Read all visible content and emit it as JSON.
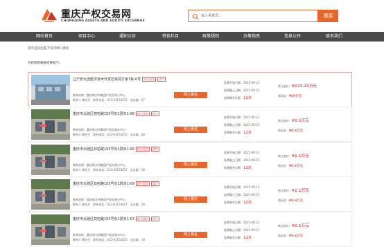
{
  "colors": {
    "accent": "#e8662c",
    "nav_bg": "#4a4a4a",
    "tag_red": "#e85d5d"
  },
  "header": {
    "title": "重庆产权交易网",
    "subtitle": "CHONGQING ASSETS AND EQUITY EXCHANGE",
    "logo_icon": "cqee-logo-icon"
  },
  "search": {
    "icon": "search-icon",
    "placeholder": "输入关键词...",
    "button_label": "搜索"
  },
  "nav": {
    "items": [
      "网站首页",
      "项目中心",
      "通知公告",
      "特色栏目",
      "政策规则",
      "办事指南",
      "信息公开",
      "联系我们"
    ]
  },
  "breadcrumb": "您的当前位置:产权项目>搜索",
  "result_label": "为您找到相关结果如下。",
  "listings": [
    {
      "title": "辽宁省大连经济技术开发区城润万家7栋-6号",
      "tags": [
        "地方国资",
        "资产"
      ],
      "org": "联系机构：重庆联交所集团产权交易分中心",
      "contact": "联系人:周先生",
      "phone": "联系电话：023-63153657",
      "views": "点击量：57",
      "signup": "网上报名",
      "start_date": "挂牌开始日期：2025-09-12",
      "end_date": "挂牌截止日期：2025-09-25",
      "days_label": "挂牌剩余天数：",
      "days": "11天",
      "price_label": "转让底价：",
      "price": "¥233.15万元",
      "deposit_label": "保证金：",
      "deposit": "¥69万元"
    },
    {
      "title": "重庆市北碚区双柏路105号负1层负1-68",
      "tags": [
        "地方国资",
        "资产"
      ],
      "org": "联系机构：重庆联交所集团产权交易分中心",
      "contact": "联系人:周先生",
      "phone": "联系电话：023-63153657",
      "views": "点击量：28",
      "signup": "网上报名",
      "start_date": "挂牌开始日期：2025-09-12",
      "end_date": "挂牌截止日期：2025-09-25",
      "days_label": "挂牌剩余天数：",
      "days": "11天",
      "price_label": "转让底价：",
      "price": "¥2.1万元",
      "deposit_label": "保证金：",
      "deposit": "¥0.6万元"
    },
    {
      "title": "重庆市北碚区双柏路105号负1层负1-66",
      "tags": [
        "地方国资",
        "资产"
      ],
      "org": "联系机构：重庆联交所集团产权交易分中心",
      "contact": "联系人:周先生",
      "phone": "联系电话：023-63153657",
      "views": "点击量：18",
      "signup": "网上报名",
      "start_date": "挂牌开始日期：2025-09-12",
      "end_date": "挂牌截止日期：2025-09-25",
      "days_label": "挂牌剩余天数：",
      "days": "11天",
      "price_label": "转让底价：",
      "price": "¥2.1万元",
      "deposit_label": "保证金：",
      "deposit": "¥0.6万元"
    },
    {
      "title": "重庆市北碚区双柏路105号负1层负1-69",
      "tags": [
        "地方国资",
        "资产"
      ],
      "org": "联系机构：重庆联交所集团产权交易分中心",
      "contact": "联系人:周先生",
      "phone": "联系电话：023-63153657",
      "views": "点击量：28",
      "signup": "网上报名",
      "start_date": "挂牌开始日期：2025-09-12",
      "end_date": "挂牌截止日期：2025-09-25",
      "days_label": "挂牌剩余天数：",
      "days": "11天",
      "price_label": "转让底价：",
      "price": "¥2.1万元",
      "deposit_label": "保证金：",
      "deposit": "¥0.6万元"
    },
    {
      "title": "重庆市北碚区双柏路105号负1层负1-67",
      "tags": [
        "地方国资",
        "资产"
      ],
      "org": "联系机构：重庆联交所集团产权交易分中心",
      "contact": "联系人:周先生",
      "phone": "联系电话：023-63153657",
      "views": "点击量：18",
      "signup": "网上报名",
      "start_date": "挂牌开始日期：2025-09-12",
      "end_date": "挂牌截止日期：2025-09-25",
      "days_label": "挂牌剩余天数：",
      "days": "11天",
      "price_label": "转让底价：",
      "price": "¥2.1万元",
      "deposit_label": "保证金：",
      "deposit": "¥0.6万元"
    }
  ]
}
